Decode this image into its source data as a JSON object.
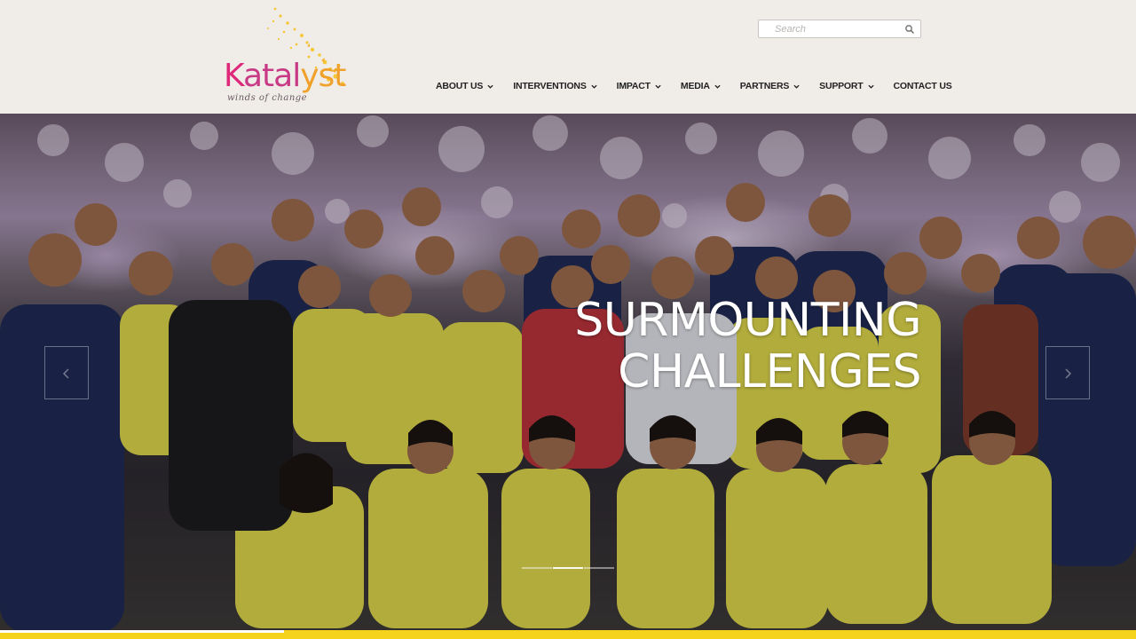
{
  "brand": {
    "name_k": "K",
    "name_rest": "atal",
    "name_st": "yst",
    "tagline": "winds of change"
  },
  "search": {
    "placeholder": "Search"
  },
  "nav": {
    "items": [
      {
        "label": "ABOUT US",
        "has_dropdown": true
      },
      {
        "label": "INTERVENTIONS",
        "has_dropdown": true
      },
      {
        "label": "IMPACT",
        "has_dropdown": true
      },
      {
        "label": "MEDIA",
        "has_dropdown": true
      },
      {
        "label": "PARTNERS",
        "has_dropdown": true
      },
      {
        "label": "SUPPORT",
        "has_dropdown": true
      },
      {
        "label": "CONTACT US",
        "has_dropdown": false
      }
    ]
  },
  "hero": {
    "title_line1": "SURMOUNTING",
    "title_line2": "CHALLENGES",
    "slides_total": 3,
    "active_slide": 1
  },
  "slider_progress": 0.25,
  "colors": {
    "brand_pink": "#e0287a",
    "brand_orange": "#f0a12b",
    "accent_yellow": "#f5d21c",
    "header_bg": "#f0ede9"
  }
}
